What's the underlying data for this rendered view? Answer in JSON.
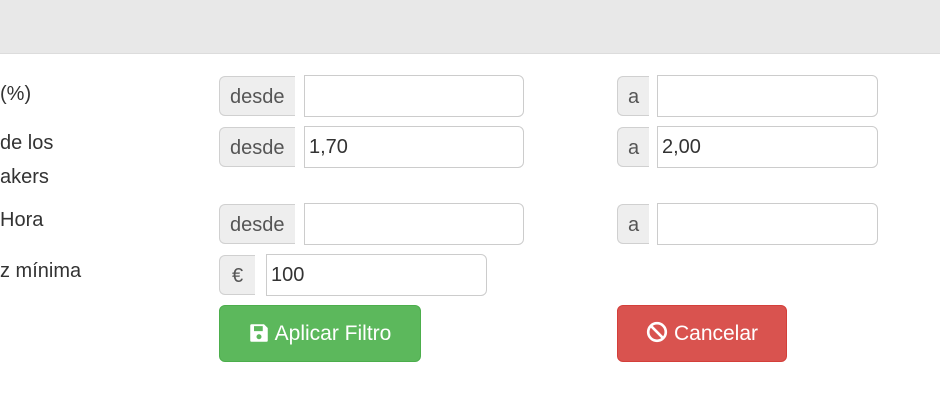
{
  "labels": {
    "row1": "(%)",
    "row2_line1": "de los",
    "row2_line2": "akers",
    "row3": "Hora",
    "row4": "z mínima"
  },
  "rows": [
    {
      "from_addon": "desde",
      "from_value": "",
      "to_addon": "a",
      "to_value": ""
    },
    {
      "from_addon": "desde",
      "from_value": "1,70",
      "to_addon": "a",
      "to_value": "2,00"
    },
    {
      "from_addon": "desde",
      "from_value": "",
      "to_addon": "a",
      "to_value": ""
    }
  ],
  "liquidity": {
    "currency": "€",
    "value": "100"
  },
  "buttons": {
    "apply": "Aplicar Filtro",
    "cancel": "Cancelar"
  },
  "icons": {
    "apply": "save-icon",
    "cancel": "ban-icon"
  },
  "colors": {
    "apply_bg": "#5cb85c",
    "cancel_bg": "#d9534f",
    "header_bg": "#e8e8e8"
  }
}
